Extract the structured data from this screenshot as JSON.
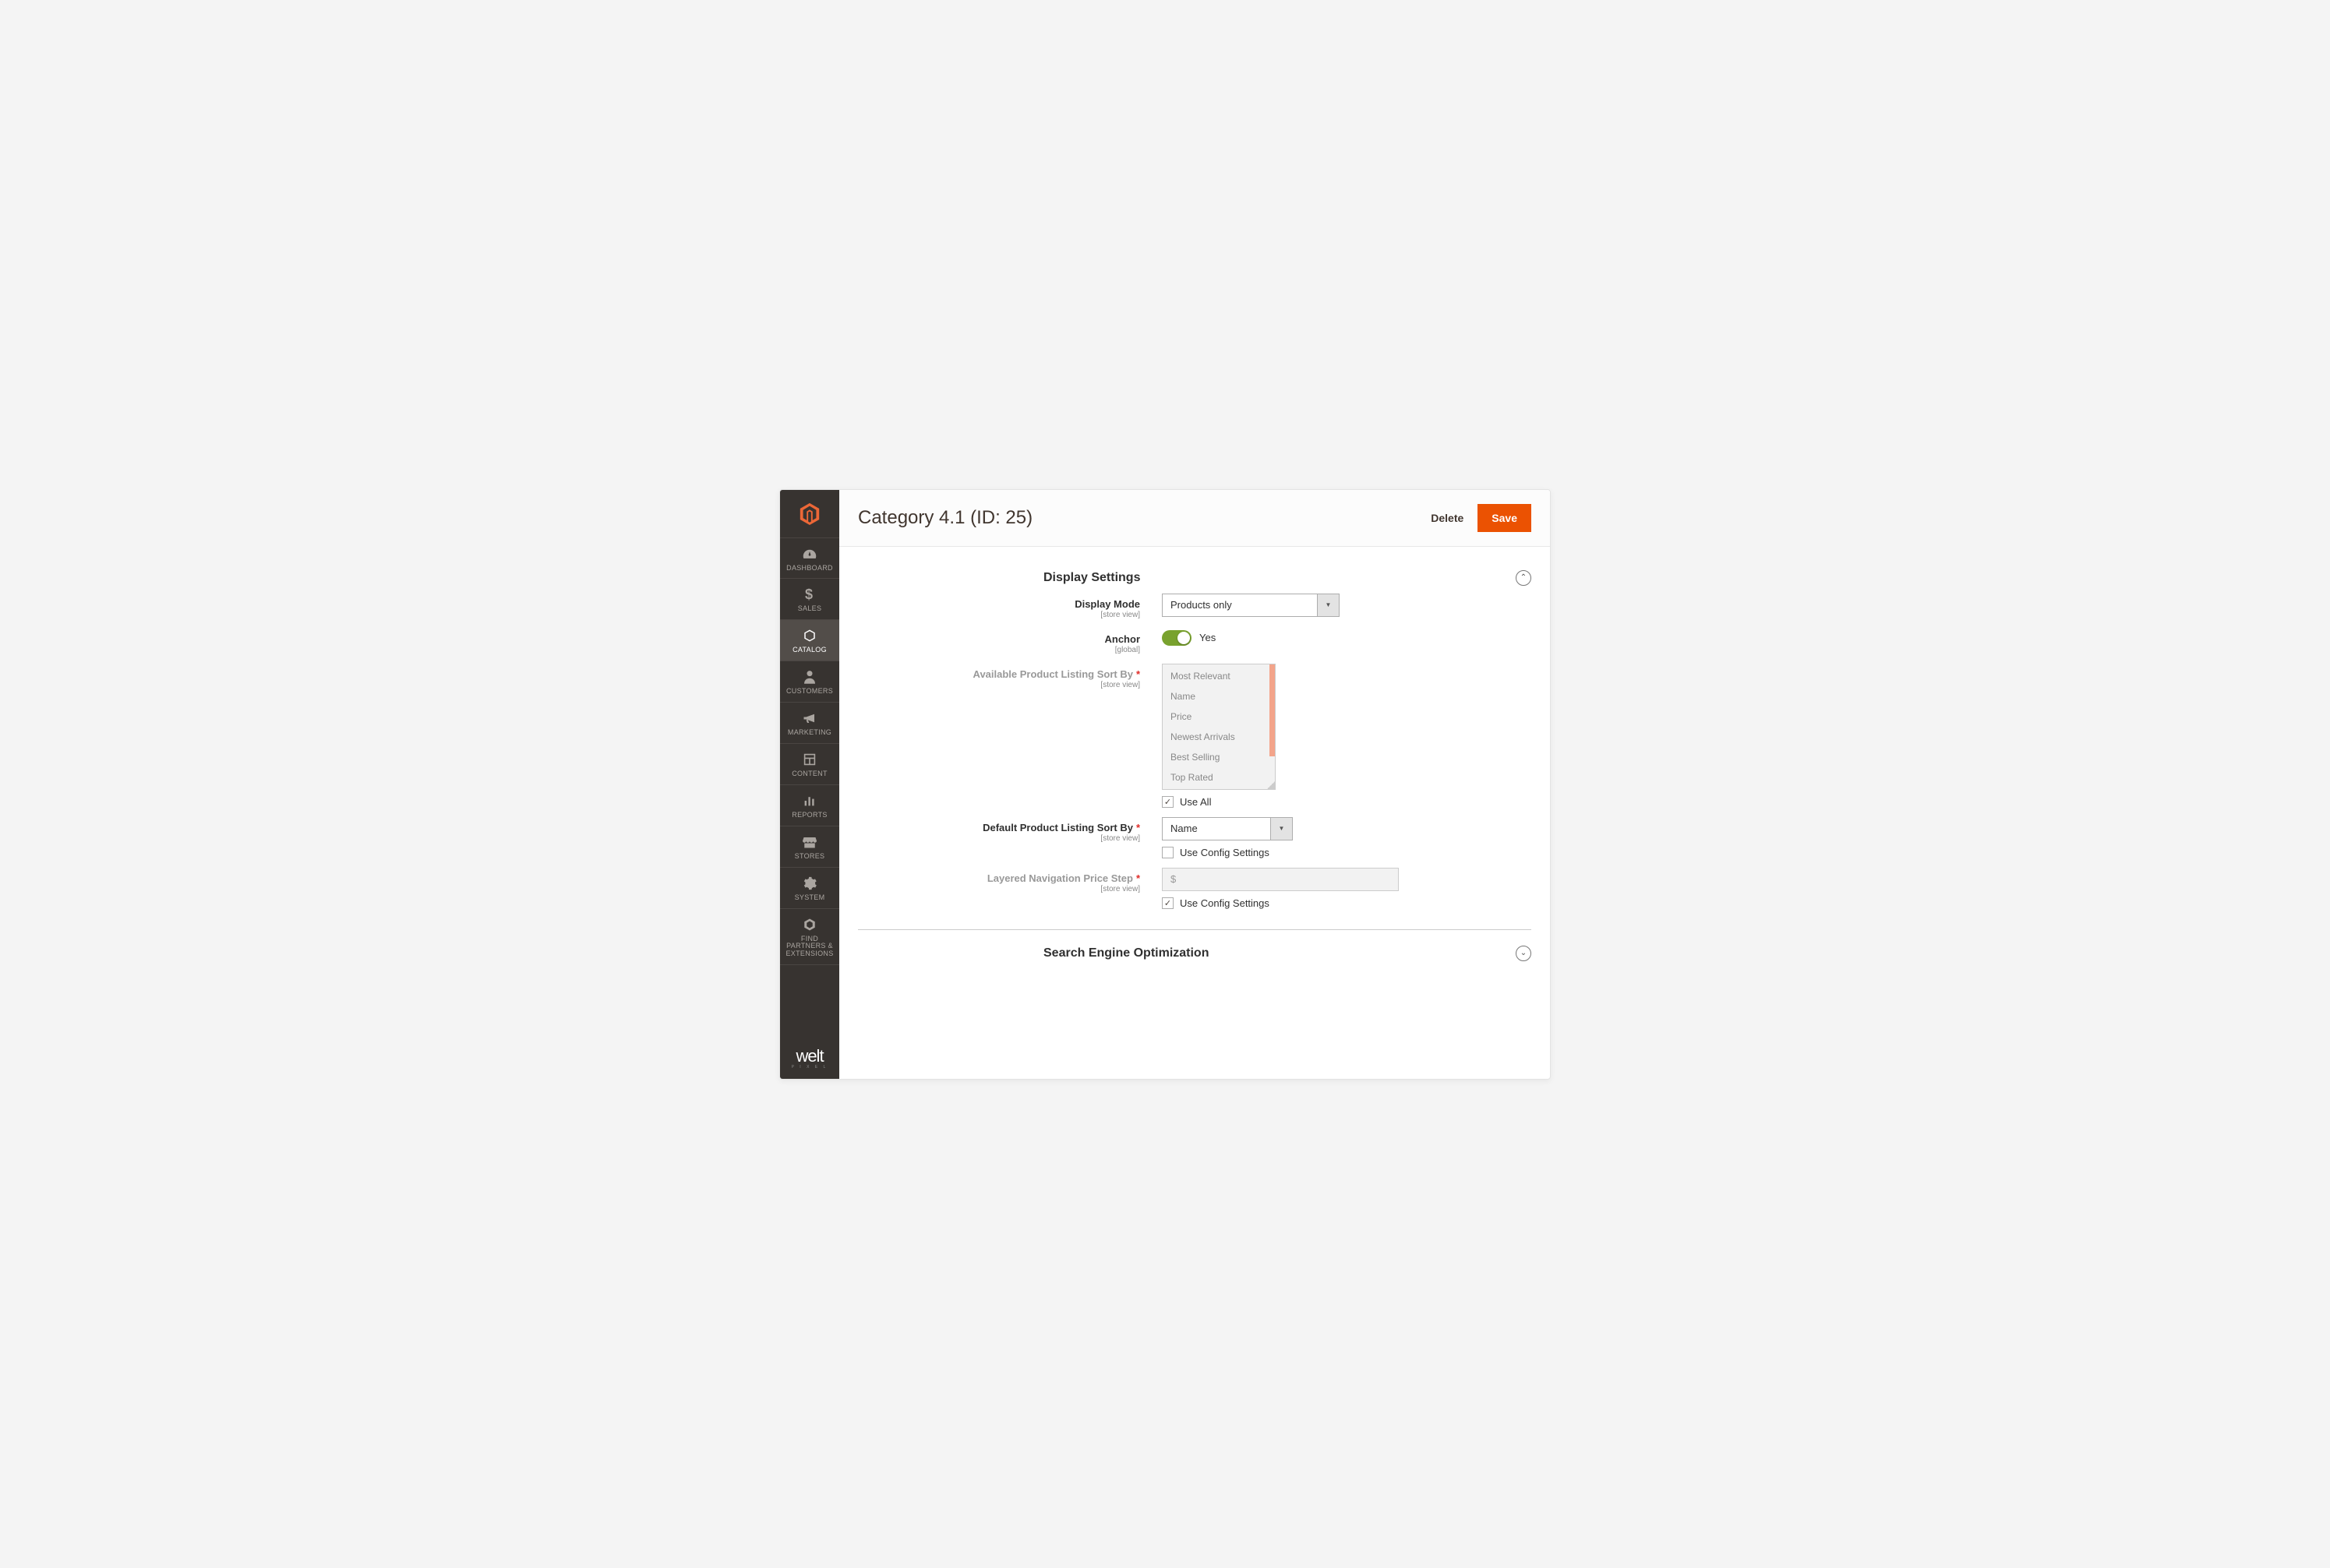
{
  "header": {
    "title": "Category 4.1 (ID: 25)",
    "delete": "Delete",
    "save": "Save"
  },
  "sidebar": {
    "items": [
      {
        "label": "DASHBOARD"
      },
      {
        "label": "SALES"
      },
      {
        "label": "CATALOG"
      },
      {
        "label": "CUSTOMERS"
      },
      {
        "label": "MARKETING"
      },
      {
        "label": "CONTENT"
      },
      {
        "label": "REPORTS"
      },
      {
        "label": "STORES"
      },
      {
        "label": "SYSTEM"
      },
      {
        "label": "FIND PARTNERS & EXTENSIONS"
      }
    ]
  },
  "sections": {
    "display": {
      "title": "Display Settings",
      "fields": {
        "display_mode": {
          "label": "Display Mode",
          "scope": "[store view]",
          "value": "Products only"
        },
        "anchor": {
          "label": "Anchor",
          "scope": "[global]",
          "value": "Yes"
        },
        "available_sort": {
          "label": "Available Product Listing Sort By",
          "scope": "[store view]",
          "options": [
            "Most Relevant",
            "Name",
            "Price",
            "Newest Arrivals",
            "Best Selling",
            "Top Rated"
          ],
          "use_all": "Use All"
        },
        "default_sort": {
          "label": "Default Product Listing Sort By",
          "scope": "[store view]",
          "value": "Name",
          "use_config": "Use Config Settings"
        },
        "price_step": {
          "label": "Layered Navigation Price Step",
          "scope": "[store view]",
          "prefix": "$",
          "use_config": "Use Config Settings"
        }
      }
    },
    "seo": {
      "title": "Search Engine Optimization"
    }
  }
}
